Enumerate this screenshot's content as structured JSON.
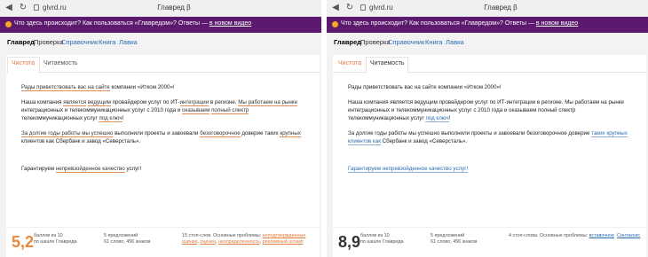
{
  "browser": {
    "url": "glvrd.ru",
    "title": "Главред β"
  },
  "banner": {
    "text_before": "Что здесь происходит? Как пользоваться «Главредом»? Ответы — ",
    "link": "в новом видео"
  },
  "nav": {
    "items": [
      "Главред",
      "Проверка",
      "Справочник",
      "Книга",
      "Лавка"
    ]
  },
  "left": {
    "tabs": [
      "Чистота",
      "Читаемость"
    ],
    "p1": {
      "a": "Рады приветствовать вас на сайте",
      "b": " компании «Итком 2000»!"
    },
    "p2": {
      "a": "Наша компания ",
      "b": "является",
      "c": " ",
      "d": "ведущим",
      "e": " провайдером услуг по ИТ-",
      "f": "интеграции",
      "g": " в регионе. ",
      "h": "Мы работаем на рынке",
      "i": " интеграционных и телекоммуникационных услуг с 2010 года и ",
      "j": "оказываем",
      "k": " ",
      "l": "полный спектр",
      "m": " телекоммуникационных услуг ",
      "n": "под ключ",
      "o": "!"
    },
    "p3": {
      "a": "За долгие годы работы мы успешно",
      "b": " выполнили проекты и завоевали ",
      "c": "безоговорочное",
      "d": " доверие таких ",
      "e": "крупных",
      "f": " клиентов как Сбербанк и завод «Северсталь»."
    },
    "p4": {
      "a": "Гарантируем ",
      "b": "непревзойденное качество",
      "c": " услуг!"
    },
    "footer": {
      "score": "5,2",
      "score_label": [
        "баллов из 10",
        "по шкале Главреда"
      ],
      "sentences": [
        "5 предложений",
        "61 слово, 456 знаков"
      ],
      "problems_lead": "15 стоп-слов. Основные проблемы: ",
      "problem_1": "неподтвержденные оценки",
      "problem_2": "оценка",
      "problem_3": "неопределенность",
      "problem_4": "рекламный штамп"
    }
  },
  "right": {
    "tabs": [
      "Чистота",
      "Читаемость"
    ],
    "p1": "Рады приветствовать вас на сайте компании «Итком 2000»!",
    "p2": {
      "a": "Наша компания является ведущим провайдером услуг по ИТ-интеграции в регионе. Мы работаем на рынке интеграционных и телекоммуникационных услуг с 2010 года и оказываем полный спектр телекоммуникационных услуг ",
      "b": "под ключ",
      "c": "!"
    },
    "p3": {
      "a": "За долгие годы работы мы успешно выполнили проекты и завоевали безоговорочное доверие ",
      "b": "таких крупных клиентов как",
      "c": " Сбербанк и завод «Северсталь»."
    },
    "p4": "Гарантируем непревзойденное качество услуг!",
    "footer": {
      "score": "8,9",
      "score_label": [
        "баллов из 10",
        "по шкале Главреда"
      ],
      "sentences": [
        "5 предложений",
        "61 слово, 456 знаков"
      ],
      "problems_lead": "4 стоп-слова. Основные проблемы: ",
      "problem_1": "вставочное",
      "problem_2": "Синтаксис"
    }
  }
}
